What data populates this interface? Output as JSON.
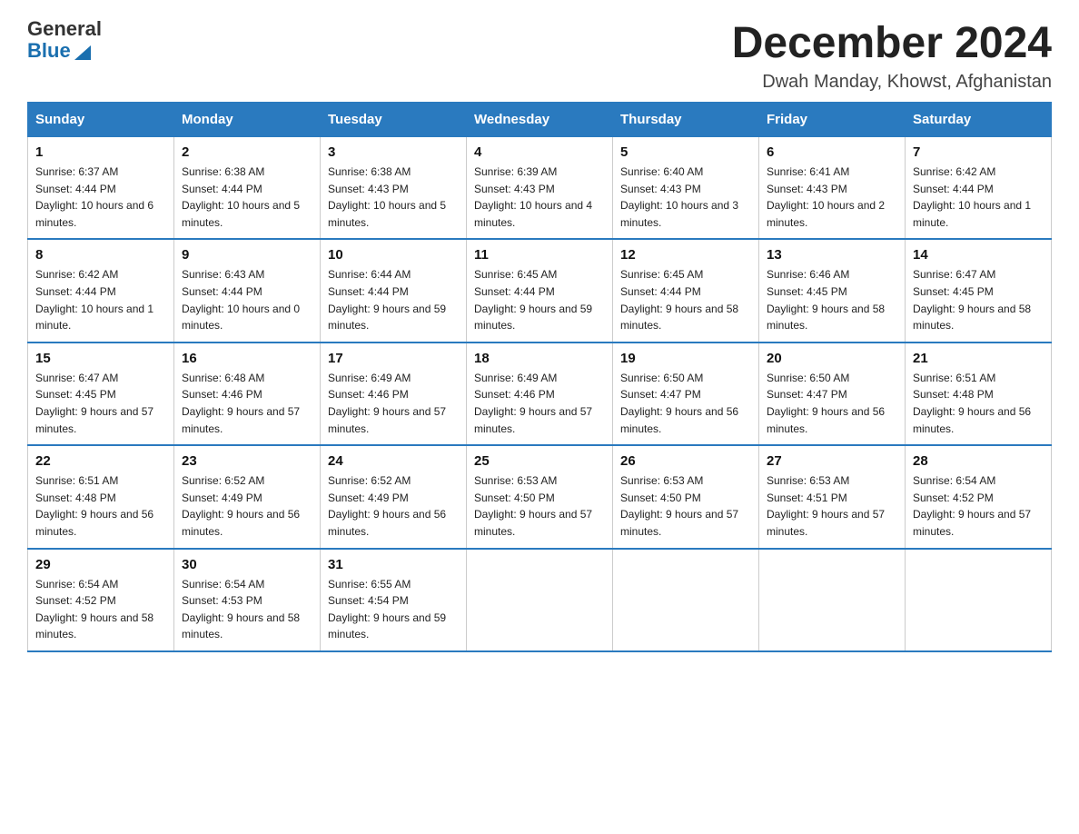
{
  "header": {
    "logo_general": "General",
    "logo_blue": "Blue",
    "month_title": "December 2024",
    "location": "Dwah Manday, Khowst, Afghanistan"
  },
  "days_of_week": [
    "Sunday",
    "Monday",
    "Tuesday",
    "Wednesday",
    "Thursday",
    "Friday",
    "Saturday"
  ],
  "weeks": [
    [
      {
        "day": "1",
        "sunrise": "6:37 AM",
        "sunset": "4:44 PM",
        "daylight": "10 hours and 6 minutes."
      },
      {
        "day": "2",
        "sunrise": "6:38 AM",
        "sunset": "4:44 PM",
        "daylight": "10 hours and 5 minutes."
      },
      {
        "day": "3",
        "sunrise": "6:38 AM",
        "sunset": "4:43 PM",
        "daylight": "10 hours and 5 minutes."
      },
      {
        "day": "4",
        "sunrise": "6:39 AM",
        "sunset": "4:43 PM",
        "daylight": "10 hours and 4 minutes."
      },
      {
        "day": "5",
        "sunrise": "6:40 AM",
        "sunset": "4:43 PM",
        "daylight": "10 hours and 3 minutes."
      },
      {
        "day": "6",
        "sunrise": "6:41 AM",
        "sunset": "4:43 PM",
        "daylight": "10 hours and 2 minutes."
      },
      {
        "day": "7",
        "sunrise": "6:42 AM",
        "sunset": "4:44 PM",
        "daylight": "10 hours and 1 minute."
      }
    ],
    [
      {
        "day": "8",
        "sunrise": "6:42 AM",
        "sunset": "4:44 PM",
        "daylight": "10 hours and 1 minute."
      },
      {
        "day": "9",
        "sunrise": "6:43 AM",
        "sunset": "4:44 PM",
        "daylight": "10 hours and 0 minutes."
      },
      {
        "day": "10",
        "sunrise": "6:44 AM",
        "sunset": "4:44 PM",
        "daylight": "9 hours and 59 minutes."
      },
      {
        "day": "11",
        "sunrise": "6:45 AM",
        "sunset": "4:44 PM",
        "daylight": "9 hours and 59 minutes."
      },
      {
        "day": "12",
        "sunrise": "6:45 AM",
        "sunset": "4:44 PM",
        "daylight": "9 hours and 58 minutes."
      },
      {
        "day": "13",
        "sunrise": "6:46 AM",
        "sunset": "4:45 PM",
        "daylight": "9 hours and 58 minutes."
      },
      {
        "day": "14",
        "sunrise": "6:47 AM",
        "sunset": "4:45 PM",
        "daylight": "9 hours and 58 minutes."
      }
    ],
    [
      {
        "day": "15",
        "sunrise": "6:47 AM",
        "sunset": "4:45 PM",
        "daylight": "9 hours and 57 minutes."
      },
      {
        "day": "16",
        "sunrise": "6:48 AM",
        "sunset": "4:46 PM",
        "daylight": "9 hours and 57 minutes."
      },
      {
        "day": "17",
        "sunrise": "6:49 AM",
        "sunset": "4:46 PM",
        "daylight": "9 hours and 57 minutes."
      },
      {
        "day": "18",
        "sunrise": "6:49 AM",
        "sunset": "4:46 PM",
        "daylight": "9 hours and 57 minutes."
      },
      {
        "day": "19",
        "sunrise": "6:50 AM",
        "sunset": "4:47 PM",
        "daylight": "9 hours and 56 minutes."
      },
      {
        "day": "20",
        "sunrise": "6:50 AM",
        "sunset": "4:47 PM",
        "daylight": "9 hours and 56 minutes."
      },
      {
        "day": "21",
        "sunrise": "6:51 AM",
        "sunset": "4:48 PM",
        "daylight": "9 hours and 56 minutes."
      }
    ],
    [
      {
        "day": "22",
        "sunrise": "6:51 AM",
        "sunset": "4:48 PM",
        "daylight": "9 hours and 56 minutes."
      },
      {
        "day": "23",
        "sunrise": "6:52 AM",
        "sunset": "4:49 PM",
        "daylight": "9 hours and 56 minutes."
      },
      {
        "day": "24",
        "sunrise": "6:52 AM",
        "sunset": "4:49 PM",
        "daylight": "9 hours and 56 minutes."
      },
      {
        "day": "25",
        "sunrise": "6:53 AM",
        "sunset": "4:50 PM",
        "daylight": "9 hours and 57 minutes."
      },
      {
        "day": "26",
        "sunrise": "6:53 AM",
        "sunset": "4:50 PM",
        "daylight": "9 hours and 57 minutes."
      },
      {
        "day": "27",
        "sunrise": "6:53 AM",
        "sunset": "4:51 PM",
        "daylight": "9 hours and 57 minutes."
      },
      {
        "day": "28",
        "sunrise": "6:54 AM",
        "sunset": "4:52 PM",
        "daylight": "9 hours and 57 minutes."
      }
    ],
    [
      {
        "day": "29",
        "sunrise": "6:54 AM",
        "sunset": "4:52 PM",
        "daylight": "9 hours and 58 minutes."
      },
      {
        "day": "30",
        "sunrise": "6:54 AM",
        "sunset": "4:53 PM",
        "daylight": "9 hours and 58 minutes."
      },
      {
        "day": "31",
        "sunrise": "6:55 AM",
        "sunset": "4:54 PM",
        "daylight": "9 hours and 59 minutes."
      },
      null,
      null,
      null,
      null
    ]
  ]
}
